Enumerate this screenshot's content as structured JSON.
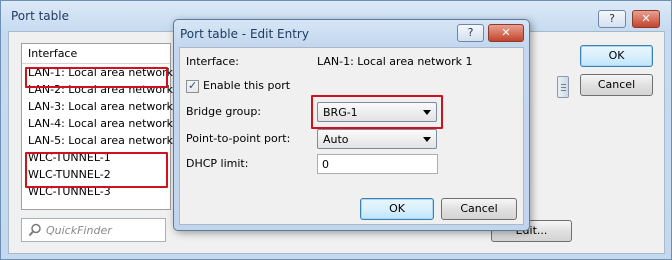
{
  "window": {
    "title": "Port table",
    "help_label": "?",
    "close_label": "✕"
  },
  "list": {
    "header": "Interface",
    "rows": [
      "LAN-1: Local area network 1",
      "LAN-2: Local area network 2",
      "LAN-3: Local area network 3",
      "LAN-4: Local area network 4",
      "LAN-5: Local area network 5",
      "WLC-TUNNEL-1",
      "WLC-TUNNEL-2",
      "WLC-TUNNEL-3"
    ]
  },
  "quickfinder": {
    "placeholder": "QuickFinder"
  },
  "main_buttons": {
    "ok": "OK",
    "cancel": "Cancel",
    "edit": "Edit..."
  },
  "dialog": {
    "title": "Port table - Edit Entry",
    "help_label": "?",
    "close_label": "✕",
    "interface_label": "Interface:",
    "interface_value": "LAN-1: Local area network 1",
    "enable_label": "Enable this port",
    "enable_checked": true,
    "bridge_label": "Bridge group:",
    "bridge_value": "BRG-1",
    "p2p_label": "Point-to-point port:",
    "p2p_value": "Auto",
    "dhcp_label": "DHCP limit:",
    "dhcp_value": "0",
    "ok": "OK",
    "cancel": "Cancel"
  },
  "colors": {
    "highlight_box": "#d0121f"
  }
}
